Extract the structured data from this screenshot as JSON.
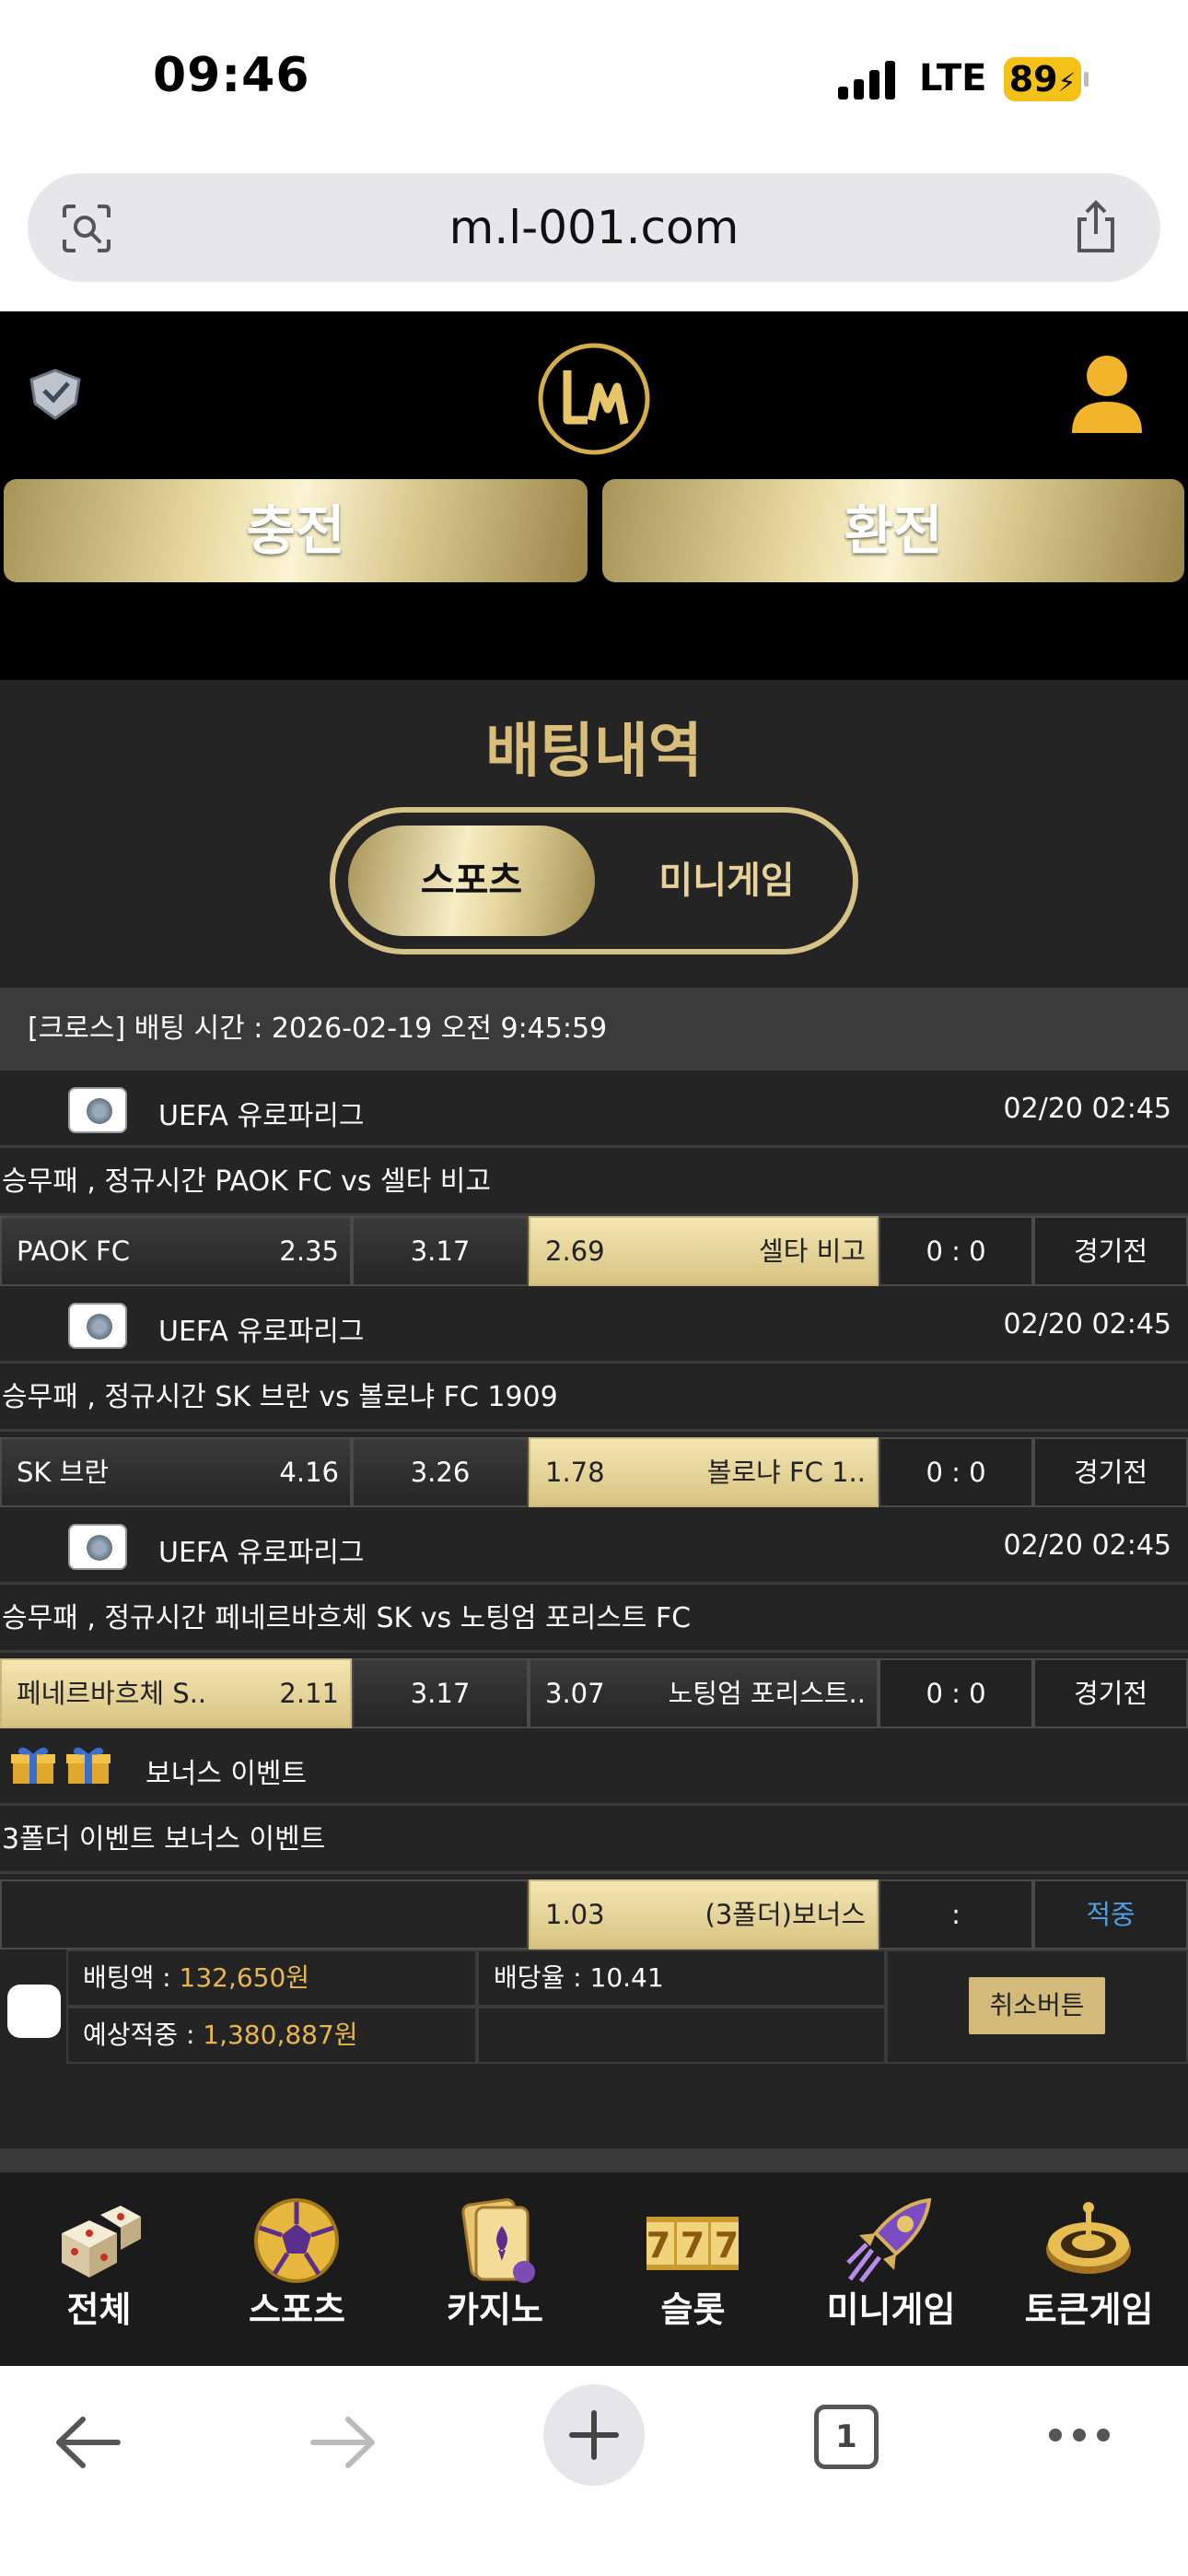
{
  "status_bar": {
    "time": "09:46",
    "network": "LTE",
    "battery": "89"
  },
  "browser": {
    "url": "m.l-001.com",
    "tab_count": "1"
  },
  "header": {
    "deposit_label": "충전",
    "withdraw_label": "환전"
  },
  "main": {
    "title": "배팅내역",
    "tabs": [
      {
        "label": "스포츠",
        "active": true
      },
      {
        "label": "미니게임",
        "active": false
      }
    ],
    "bet_header": "[크로스] 배팅 시간 : 2026-02-19 오전 9:45:59",
    "matches": [
      {
        "league": "UEFA 유로파리그",
        "date": "02/20 02:45",
        "title": "승무패 , 정규시간 PAOK FC  vs  셀타 비고",
        "home": "PAOK FC",
        "home_odds": "2.35",
        "draw_odds": "3.17",
        "away_odds": "2.69",
        "away": "셀타 비고",
        "score": "0 : 0",
        "status": "경기전",
        "selected": "away"
      },
      {
        "league": "UEFA 유로파리그",
        "date": "02/20 02:45",
        "title": "승무패 , 정규시간 SK 브란  vs  볼로냐 FC 1909",
        "home": "SK 브란",
        "home_odds": "4.16",
        "draw_odds": "3.26",
        "away_odds": "1.78",
        "away": "볼로냐 FC 1..",
        "score": "0 : 0",
        "status": "경기전",
        "selected": "away"
      },
      {
        "league": "UEFA 유로파리그",
        "date": "02/20 02:45",
        "title": "승무패 , 정규시간 페네르바흐체 SK  vs  노팅엄 포리스트 FC",
        "home": "페네르바흐체 S..",
        "home_odds": "2.11",
        "draw_odds": "3.17",
        "away_odds": "3.07",
        "away": "노팅엄 포리스트..",
        "score": "0 : 0",
        "status": "경기전",
        "selected": "home"
      }
    ],
    "bonus": {
      "label": "보너스 이벤트",
      "title": "3폴더 이벤트 보너스 이벤트",
      "odds": "1.03",
      "name": "(3폴더)보너스",
      "score": ":",
      "status": "적중"
    },
    "summary": {
      "bet_amount_label": "배팅액 : ",
      "bet_amount": "132,650원",
      "odds_label": "배당율 : 10.41",
      "expected_label": "예상적중 : ",
      "expected": "1,380,887원",
      "cancel_label": "취소버튼"
    }
  },
  "bottom_nav": [
    {
      "label": "전체",
      "icon": "dice-icon"
    },
    {
      "label": "스포츠",
      "icon": "soccer-ball-icon"
    },
    {
      "label": "카지노",
      "icon": "cards-icon"
    },
    {
      "label": "슬롯",
      "icon": "slot-777-icon"
    },
    {
      "label": "미니게임",
      "icon": "rocket-icon"
    },
    {
      "label": "토큰게임",
      "icon": "roulette-icon"
    }
  ],
  "colors": {
    "gold": "#d9bd7b",
    "background": "#242424",
    "accent_blue": "#4f9fe0",
    "amount": "#e9b64f"
  }
}
